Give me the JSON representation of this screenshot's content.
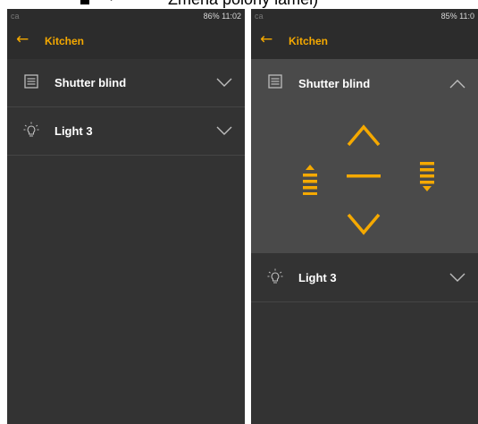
{
  "caption": {
    "text": "Změna polohy lamel)"
  },
  "left_screen": {
    "status": {
      "left": "ca",
      "right": "86% 11:02"
    },
    "header": {
      "back_label": "←",
      "title": "Kitchen"
    },
    "items": [
      {
        "label": "Shutter blind",
        "icon": "shutter-blind-icon",
        "state": "collapsed"
      },
      {
        "label": "Light 3",
        "icon": "light-bulb-icon",
        "state": "collapsed"
      }
    ]
  },
  "right_screen": {
    "status": {
      "left": "ca",
      "right": "85% 11:0"
    },
    "header": {
      "back_label": "←",
      "title": "Kitchen"
    },
    "items": [
      {
        "label": "Shutter blind",
        "icon": "shutter-blind-icon",
        "state": "expanded"
      },
      {
        "label": "Light 3",
        "icon": "light-bulb-icon",
        "state": "collapsed"
      }
    ],
    "shutter_controls": [
      "open-up",
      "slats-up",
      "stop",
      "slats-down",
      "close-down"
    ]
  },
  "colors": {
    "accent": "#f5a900",
    "background": "#333333",
    "panel_expanded": "#4a4a4a",
    "text": "#ffffff"
  }
}
